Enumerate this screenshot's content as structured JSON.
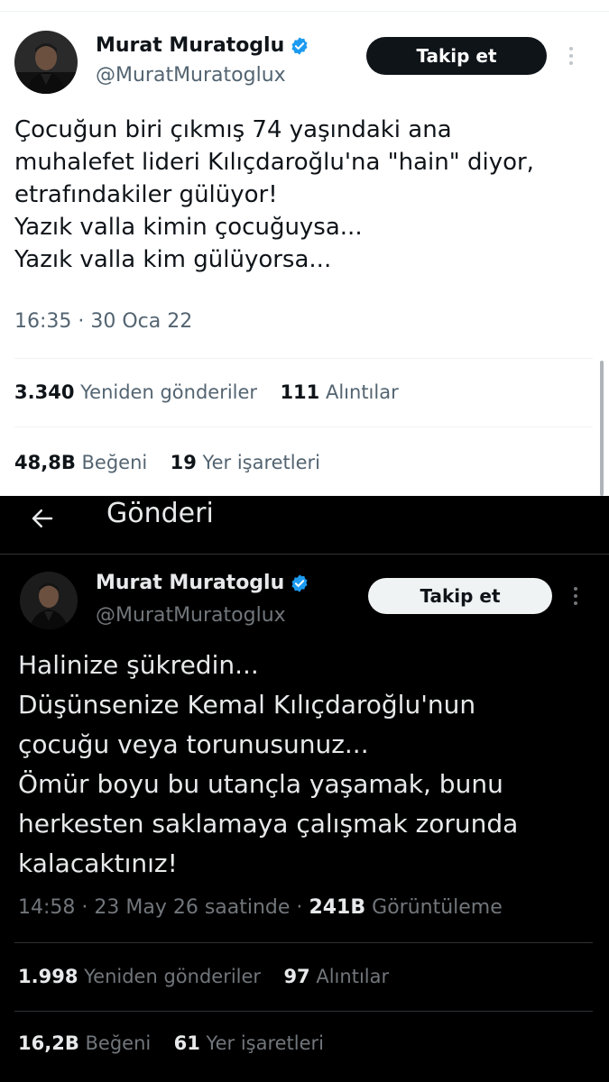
{
  "screenshot_top": {
    "author": {
      "name": "Murat Muratoglu",
      "handle": "@MuratMuratoglux",
      "verified": true
    },
    "follow_label": "Takip et",
    "text": "Çocuğun biri çıkmış 74 yaşındaki ana\nmuhalefet lideri Kılıçdaroğlu'na \"hain\" diyor,\netrafındakiler gülüyor!\nYazık valla kimin çocuğuysa...\nYazık valla kim gülüyorsa...",
    "timestamp": "16:35 · 30 Oca 22",
    "retweets": {
      "count": "3.340",
      "label": "Yeniden gönderiler"
    },
    "quotes": {
      "count": "111",
      "label": "Alıntılar"
    },
    "likes": {
      "count": "48,8B",
      "label": "Beğeni"
    },
    "bookmarks": {
      "count": "19",
      "label": "Yer işaretleri"
    }
  },
  "screenshot_bottom": {
    "header": {
      "title": "Gönderi",
      "back_icon": "arrow-left-icon"
    },
    "author": {
      "name": "Murat Muratoglu",
      "handle": "@MuratMuratoglux",
      "verified": true
    },
    "follow_label": "Takip et",
    "text": "Halinize şükredin...\nDüşünsenize Kemal Kılıçdaroğlu'nun\nçocuğu veya torunusunuz...\nÖmür boyu bu utançla yaşamak, bunu\nherkesten saklamaya çalışmak zorunda\nkalacaktınız!",
    "timestamp": "14:58 · 23 May 26 saatinde ·",
    "views": {
      "count": "241B",
      "label": "Görüntüleme"
    },
    "retweets": {
      "count": "1.998",
      "label": "Yeniden gönderiler"
    },
    "quotes": {
      "count": "97",
      "label": "Alıntılar"
    },
    "likes": {
      "count": "16,2B",
      "label": "Beğeni"
    },
    "bookmarks": {
      "count": "61",
      "label": "Yer işaretleri"
    }
  },
  "colors": {
    "verified_blue": "#1d9bf0",
    "light_bg": "#ffffff",
    "dark_bg": "#000000",
    "light_secondary": "#536471",
    "dark_secondary": "#71767b"
  }
}
